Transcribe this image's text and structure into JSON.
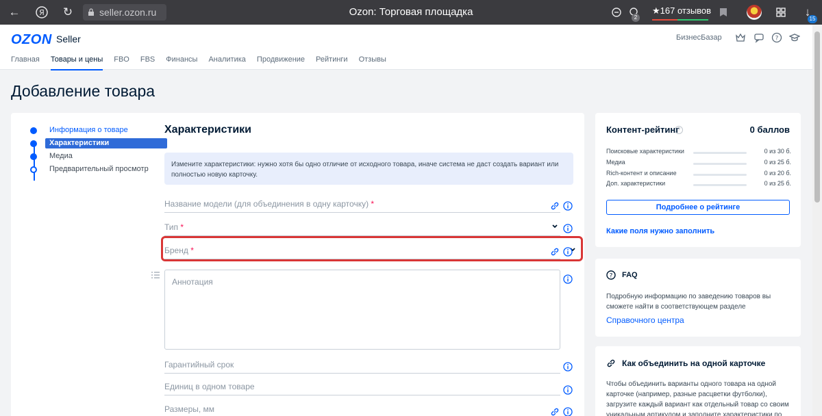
{
  "browser": {
    "url": "seller.ozon.ru",
    "title": "Ozon: Торговая площадка",
    "reviews": "★167 отзывов",
    "tab_count": "2",
    "downloads_count": "15"
  },
  "header": {
    "logo": "OZON",
    "logo_sub": "Seller",
    "biz_link": "БизнесБазар",
    "nav": [
      "Главная",
      "Товары и цены",
      "FBO",
      "FBS",
      "Финансы",
      "Аналитика",
      "Продвижение",
      "Рейтинги",
      "Отзывы"
    ],
    "active_nav": "Товары и цены"
  },
  "page": {
    "title": "Добавление товара"
  },
  "steps": [
    {
      "label": "Информация о товаре",
      "state": "done"
    },
    {
      "label": "Характеристики",
      "state": "current"
    },
    {
      "label": "Медиа",
      "state": "todo"
    },
    {
      "label": "Предварительный просмотр",
      "state": "todo"
    }
  ],
  "form": {
    "section_title": "Характеристики",
    "notice": "Измените характеристики: нужно хотя бы одно отличие от исходного товара, иначе система не даст создать вариант или полностью новую карточку.",
    "fields": {
      "model_name": "Название модели (для объединения в одну карточку)",
      "type": "Тип",
      "brand": "Бренд",
      "annotation": "Аннотация",
      "warranty": "Гарантийный срок",
      "units": "Единиц в одном товаре",
      "sizes": "Размеры, мм"
    },
    "required_mark": "*"
  },
  "rating": {
    "title": "Контент-рейтинг",
    "score": "0 баллов",
    "rows": [
      {
        "label": "Поисковые характеристики",
        "value": "0 из 30 б."
      },
      {
        "label": "Медиа",
        "value": "0 из 25 б."
      },
      {
        "label": "Rich-контент и описание",
        "value": "0 из 20 б."
      },
      {
        "label": "Доп. характеристики",
        "value": "0 из 25 б."
      }
    ],
    "button": "Подробнее о рейтинге",
    "link": "Какие поля нужно заполнить"
  },
  "faq": {
    "title": "FAQ",
    "text": "Подробную информацию по заведению товаров вы сможете найти в соответствующем разделе",
    "link": "Справочного центра"
  },
  "merge": {
    "title": "Как объединить на одной карточке",
    "text": "Чтобы объединить варианты одного товара на одной карточке (например, разные расцветки футболки), загрузите каждый вариант как отдельный товар со своим уникальным артикулом и заполните характеристики по"
  },
  "colors": {
    "accent": "#005bff",
    "required": "#f91155",
    "highlight": "#d93636"
  }
}
